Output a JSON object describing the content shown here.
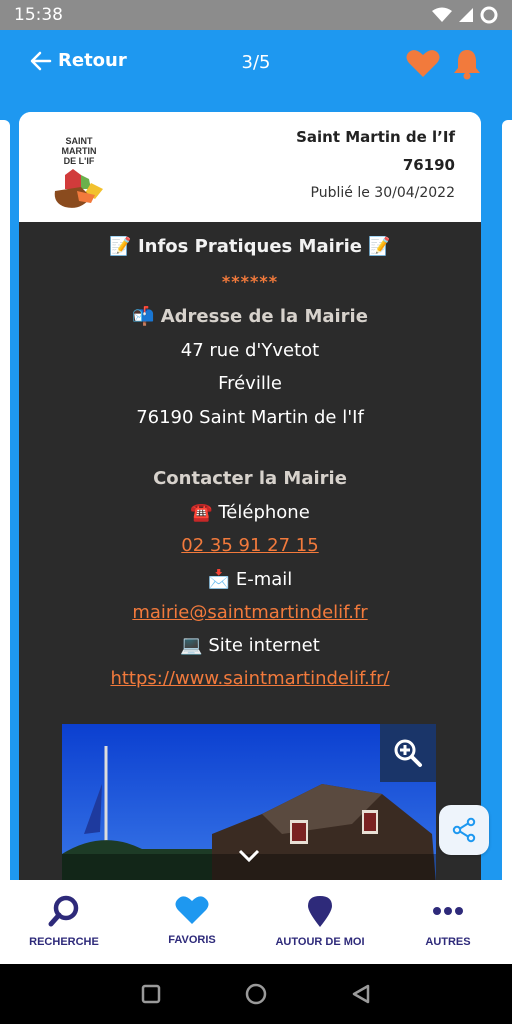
{
  "status": {
    "time": "15:38"
  },
  "header": {
    "back_label": "Retour",
    "counter": "3/5"
  },
  "card": {
    "logo_line1": "SAINT MARTIN",
    "logo_line2": "DE L'IF",
    "commune": "Saint Martin de l’If",
    "postal_code": "76190",
    "published": "Publié le 30/04/2022"
  },
  "content": {
    "title": "📝 Infos Pratiques Mairie 📝",
    "stars": "******",
    "address_title": "📬 Adresse de la Mairie",
    "address_line1": "47 rue d'Yvetot",
    "address_line2": "Fréville",
    "address_line3": "76190 Saint Martin de l'If",
    "contact_title": "Contacter la Mairie",
    "phone_label": "☎️ Téléphone",
    "phone_value": "02 35 91 27 15",
    "email_label": "📩 E-mail",
    "email_value": "mairie@saintmartindelif.fr",
    "site_label": "💻 Site internet",
    "site_value": "https://www.saintmartindelif.fr/"
  },
  "bottom_nav": [
    {
      "label": "RECHERCHE",
      "icon": "search-icon"
    },
    {
      "label": "FAVORIS",
      "icon": "heart-icon"
    },
    {
      "label": "AUTOUR DE MOI",
      "icon": "location-pin-icon"
    },
    {
      "label": "AUTRES",
      "icon": "more-dots-icon"
    }
  ],
  "colors": {
    "brand_blue": "#1e98f0",
    "accent_orange": "#f27a3c",
    "nav_purple": "#2e2a7a",
    "content_bg": "#2b2b2b"
  }
}
